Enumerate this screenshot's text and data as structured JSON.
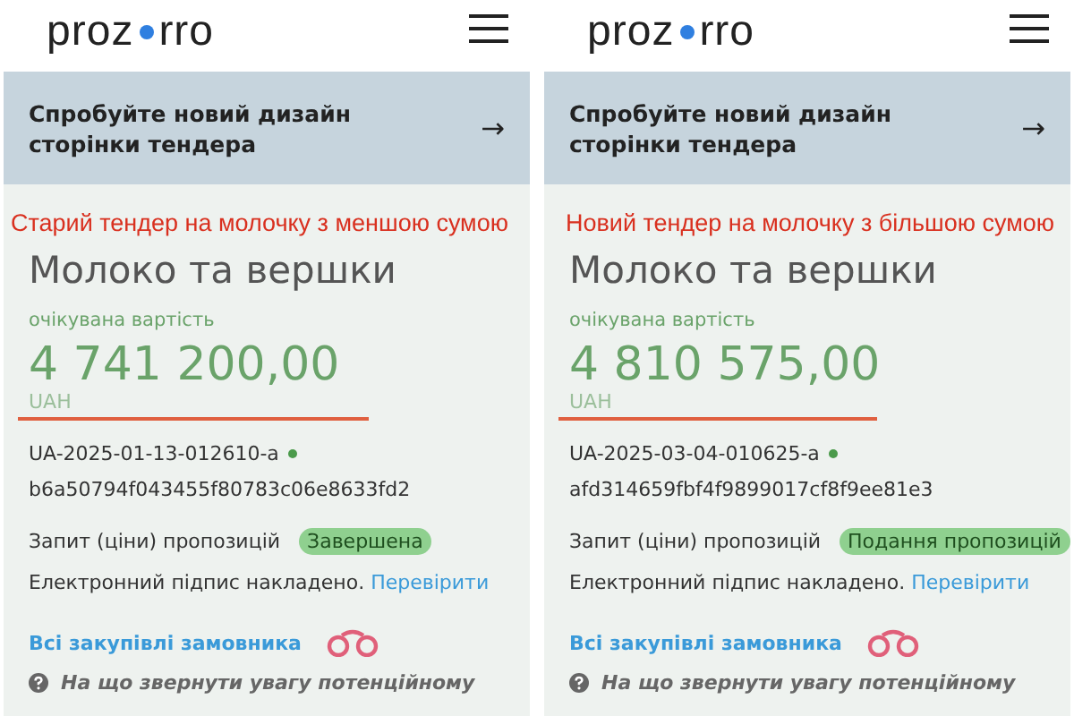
{
  "panels": [
    {
      "logo": {
        "left": "proz",
        "right": "rro"
      },
      "banner": {
        "text": "Спробуйте новий дизайн сторінки тендера",
        "arrow": "→"
      },
      "annotation": "Старий тендер на молочку з меншою сумою",
      "title": "Молоко та вершки",
      "value_label": "очікувана вартість",
      "amount": "4 741 200,00",
      "currency": "UAH",
      "tender_id": "UA-2025-01-13-012610-a",
      "hash": "b6a50794f043455f80783c06e8633fd2",
      "procedure": "Запит (ціни) пропозицій",
      "status": "Завершена",
      "signature": "Електронний підпис накладено.",
      "verify_link": "Перевірити",
      "customer_link": "Всі закупівлі замовника",
      "hint": "На що звернути увагу потенційному"
    },
    {
      "logo": {
        "left": "proz",
        "right": "rro"
      },
      "banner": {
        "text": "Спробуйте новий дизайн сторінки тендера",
        "arrow": "→"
      },
      "annotation": "Новий тендер на молочку з більшою сумою",
      "title": "Молоко та вершки",
      "value_label": "очікувана вартість",
      "amount": "4 810 575,00",
      "currency": "UAH",
      "tender_id": "UA-2025-03-04-010625-a",
      "hash": "afd314659fbf4f9899017cf8f9ee81e3",
      "procedure": "Запит (ціни) пропозицій",
      "status": "Подання пропозицій",
      "signature": "Електронний підпис накладено.",
      "verify_link": "Перевірити",
      "customer_link": "Всі закупівлі замовника",
      "hint": "На що звернути увагу потенційному"
    }
  ]
}
